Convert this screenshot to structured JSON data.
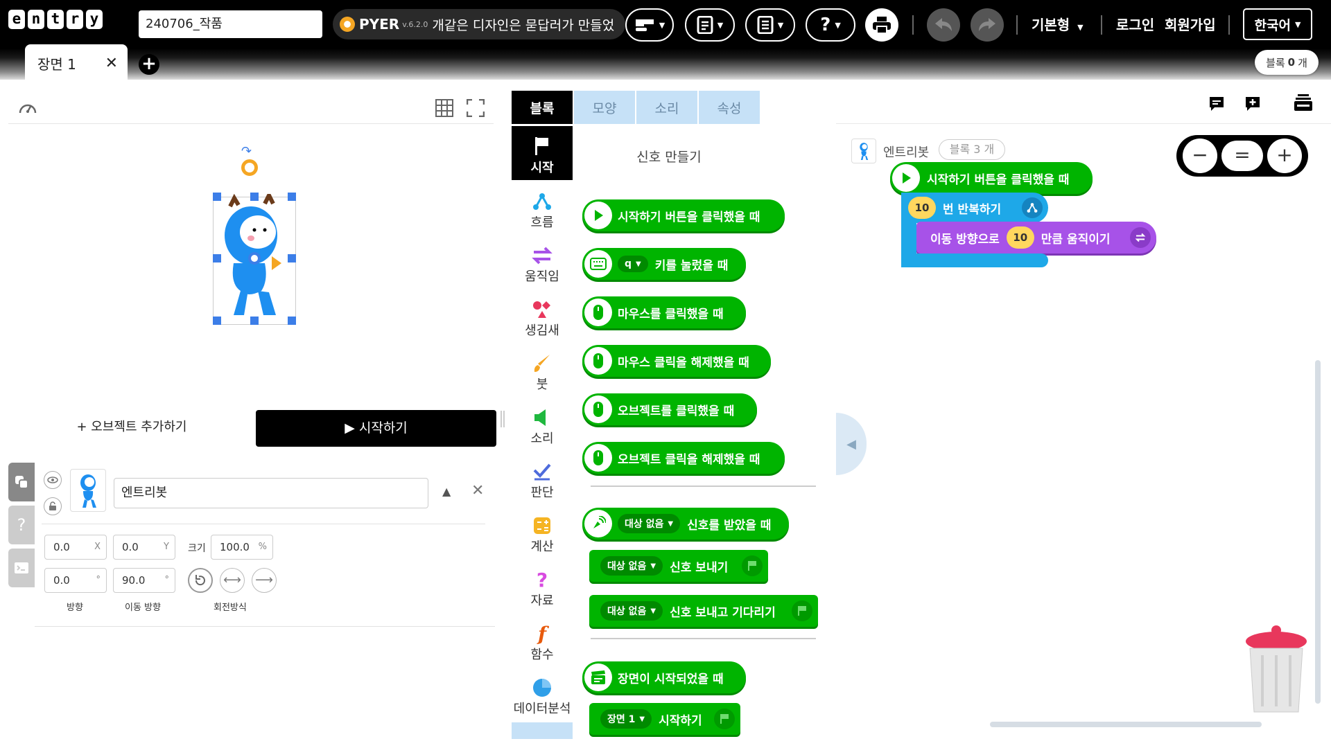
{
  "header": {
    "logo_letters": [
      "e",
      "n",
      "t",
      "r",
      "y"
    ],
    "project_name": "240706_작품",
    "ad_brand": "PYER",
    "ad_version": "v.6.2.0",
    "ad_text": "개같은 디자인은 묻답러가 만들었",
    "view_mode": "기본형",
    "login": "로그인",
    "signup": "회원가입",
    "language": "한국어"
  },
  "scene_tab": {
    "label": "장면 1"
  },
  "block_count": {
    "prefix": "블록",
    "count": "0",
    "suffix": "개"
  },
  "stage": {
    "add_object": "+ 오브젝트 추가하기",
    "start": "▶ 시작하기"
  },
  "object_panel": {
    "name": "엔트리봇",
    "x": "0.0",
    "x_unit": "X",
    "y": "0.0",
    "y_unit": "Y",
    "size_label": "크기",
    "size": "100.0",
    "size_unit": "%",
    "direction": "0.0",
    "direction_unit": "°",
    "move_direction": "90.0",
    "move_direction_unit": "°",
    "label_direction": "방향",
    "label_move_direction": "이동 방향",
    "label_rotation": "회전방식"
  },
  "palette": {
    "tabs": [
      "블록",
      "모양",
      "소리",
      "속성"
    ],
    "categories": [
      "시작",
      "흐름",
      "움직임",
      "생김새",
      "붓",
      "소리",
      "판단",
      "계산",
      "자료",
      "함수",
      "데이터분석"
    ],
    "signal_create": "신호 만들기",
    "blocks": {
      "on_start": "시작하기 버튼을 클릭했을 때",
      "key_value": "q",
      "key_pressed": "키를 눌렀을 때",
      "mouse_click": "마우스를 클릭했을 때",
      "mouse_release": "마우스 클릭을 해제했을 때",
      "object_click": "오브젝트를 클릭했을 때",
      "object_release": "오브젝트 클릭을 해제했을 때",
      "signal_target": "대상 없음",
      "signal_received": "신호를 받았을 때",
      "signal_send": "신호 보내기",
      "signal_send_wait": "신호 보내고 기다리기",
      "scene_started": "장면이 시작되었을 때",
      "scene_value": "장면 1",
      "scene_start": "시작하기"
    }
  },
  "workspace": {
    "object_name": "엔트리봇",
    "block_badge": "블록 3 개",
    "script": {
      "on_start": "시작하기 버튼을 클릭했을 때",
      "repeat_count": "10",
      "repeat_label": "번 반복하기",
      "move_prefix": "이동 방향으로",
      "move_count": "10",
      "move_suffix": "만큼 움직이기"
    },
    "zoom": {
      "minus": "−",
      "reset": "=",
      "plus": "+"
    }
  },
  "colors": {
    "start_green": "#00b400",
    "flow_blue": "#1ea8e8",
    "move_purple": "#a752e8",
    "accent_black": "#000000"
  }
}
